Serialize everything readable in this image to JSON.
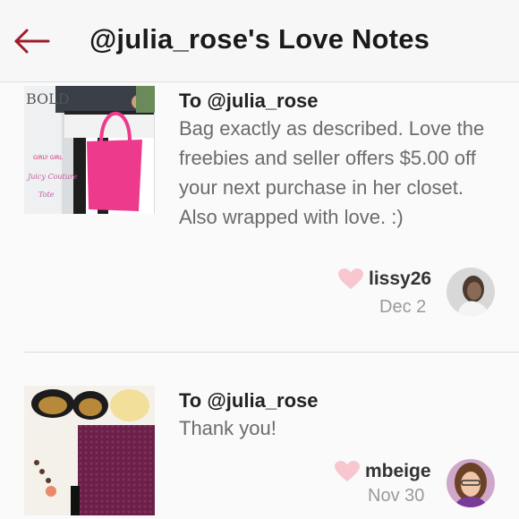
{
  "header": {
    "title": "@julia_rose's Love Notes",
    "accent_color": "#a01c2c",
    "back_icon": "back-arrow-icon"
  },
  "notes": [
    {
      "to": "To @julia_rose",
      "body": "Bag exactly as described. Love the freebies and seller offers $5.00 off your next purchase in her closet. Also wrapped with love. :)",
      "username": "lissy26",
      "date": "Dec 2",
      "heart_color": "#f7c6cf",
      "thumbnail_text": [
        "BOLD",
        "GIRLY GIRL",
        "Juicy Couture",
        "Tote"
      ]
    },
    {
      "to": "To @julia_rose",
      "body": "Thank you!",
      "username": "mbeige",
      "date": "Nov 30",
      "heart_color": "#f7c6cf"
    }
  ]
}
